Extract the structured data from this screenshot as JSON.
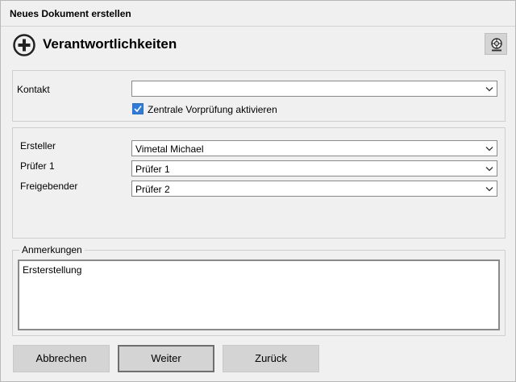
{
  "window": {
    "title": "Neues Dokument erstellen"
  },
  "header": {
    "title": "Verantwortlichkeiten",
    "add_icon": "plus-circle-icon",
    "help_icon": "lifebuoy-icon"
  },
  "contact": {
    "label": "Kontakt",
    "value": "",
    "checkbox_label": "Zentrale Vorprüfung aktivieren",
    "checkbox_checked": true
  },
  "roles": {
    "creator_label": "Ersteller",
    "creator_value": "Vimetal Michael",
    "reviewer_label": "Prüfer 1",
    "reviewer_value": "Prüfer 1",
    "approver_label": "Freigebender",
    "approver_value": "Prüfer 2"
  },
  "notes": {
    "legend": "Anmerkungen",
    "value": "Ersterstellung"
  },
  "buttons": {
    "cancel": "Abbrechen",
    "next": "Weiter",
    "back": "Zurück"
  }
}
